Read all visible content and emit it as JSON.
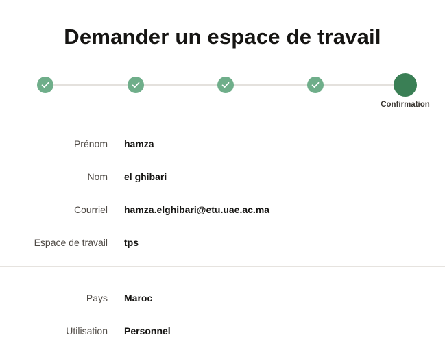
{
  "page": {
    "title": "Demander un espace de travail"
  },
  "stepper": {
    "steps": [
      {
        "status": "completed",
        "icon": "check-icon"
      },
      {
        "status": "completed",
        "icon": "check-icon"
      },
      {
        "status": "completed",
        "icon": "check-icon"
      },
      {
        "status": "completed",
        "icon": "check-icon"
      },
      {
        "status": "current",
        "label": "Confirmation"
      }
    ],
    "colors": {
      "completed": "#6fae8a",
      "current": "#3a7f55",
      "line": "#e4e1dd"
    }
  },
  "summary": {
    "personal": [
      {
        "label": "Prénom",
        "value": "hamza"
      },
      {
        "label": "Nom",
        "value": "el ghibari"
      },
      {
        "label": "Courriel",
        "value": "hamza.elghibari@etu.uae.ac.ma"
      },
      {
        "label": "Espace de travail",
        "value": "tps"
      }
    ],
    "account": [
      {
        "label": "Pays",
        "value": "Maroc"
      },
      {
        "label": "Utilisation",
        "value": "Personnel"
      }
    ]
  }
}
